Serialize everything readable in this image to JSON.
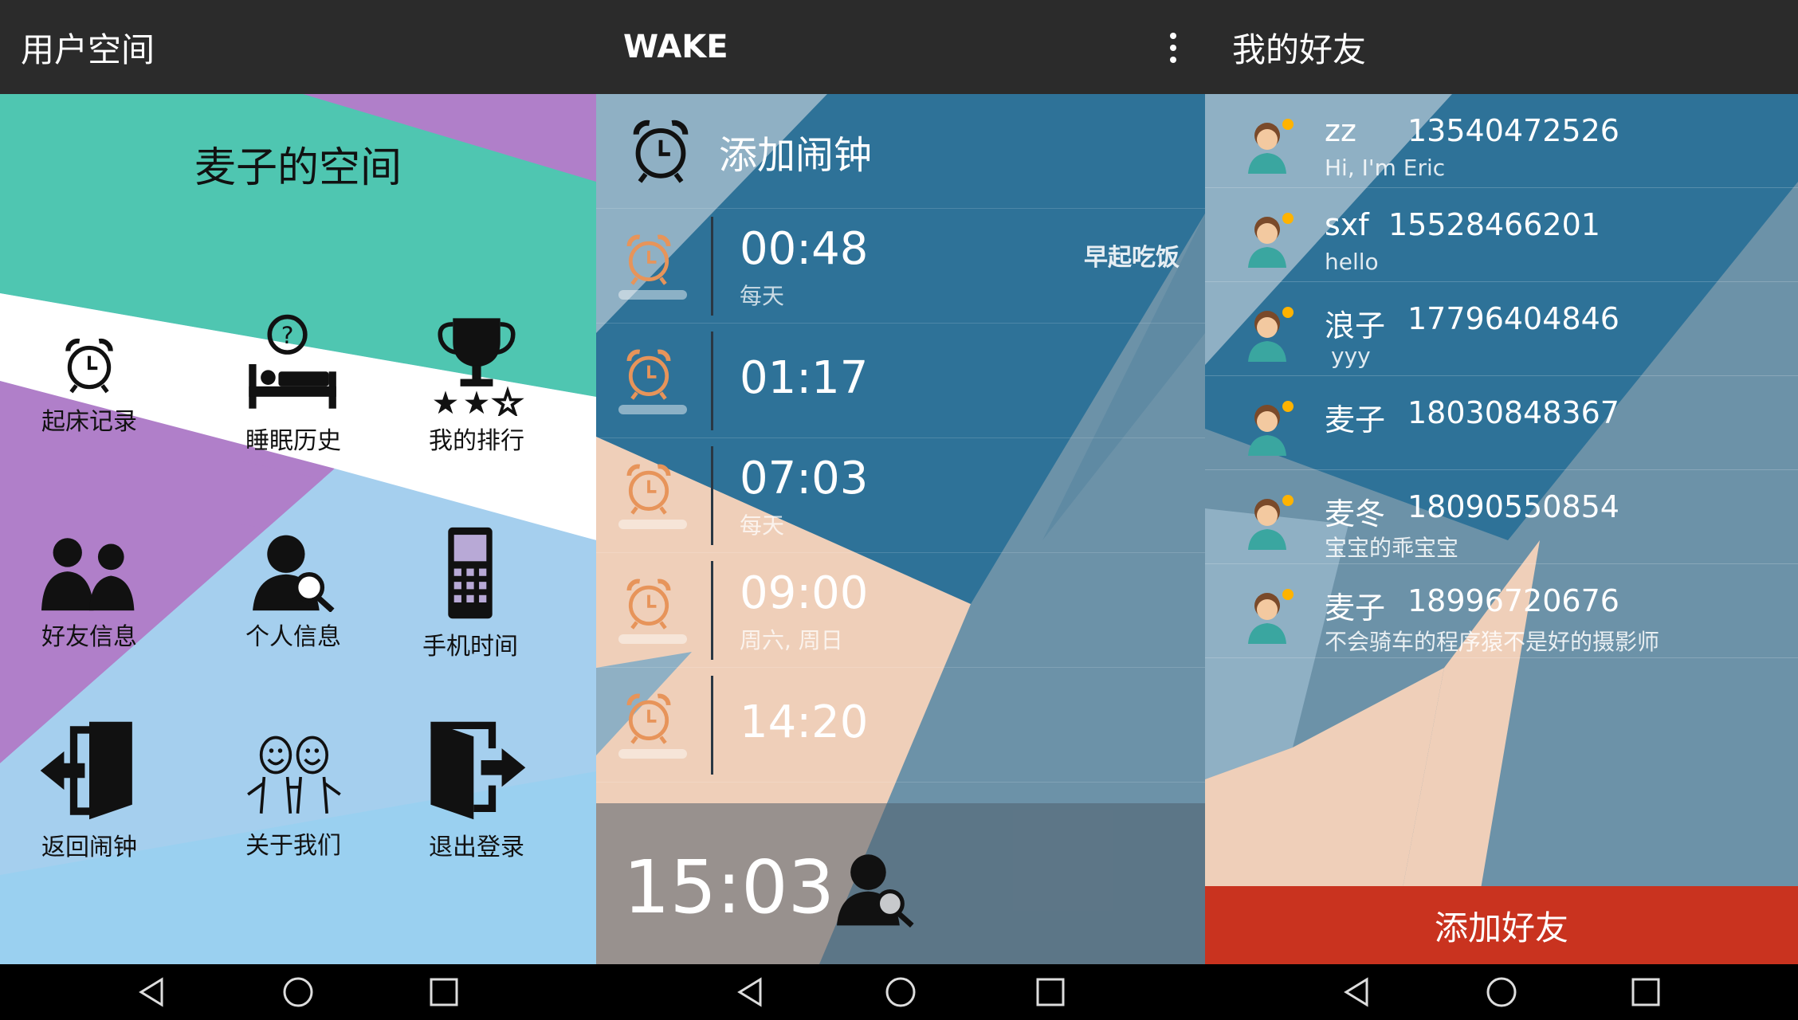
{
  "screen1": {
    "appbar_title": "用户空间",
    "space_title": "麦子的空间",
    "tiles": [
      {
        "label": "起床记录",
        "icon": "alarm-clock-icon"
      },
      {
        "label": "睡眠历史",
        "icon": "bed-question-icon"
      },
      {
        "label": "我的排行",
        "icon": "trophy-stars-icon"
      },
      {
        "label": "好友信息",
        "icon": "two-people-icon"
      },
      {
        "label": "个人信息",
        "icon": "person-search-icon"
      },
      {
        "label": "手机时间",
        "icon": "mobile-phone-icon"
      },
      {
        "label": "返回闹钟",
        "icon": "door-enter-icon"
      },
      {
        "label": "关于我们",
        "icon": "happy-people-icon"
      },
      {
        "label": "退出登录",
        "icon": "door-exit-icon"
      }
    ]
  },
  "screen2": {
    "appbar_title": "WAKE",
    "add_alarm": "添加闹钟",
    "alarms": [
      {
        "time": "00:48",
        "repeat": "每天",
        "note": "早起吃饭"
      },
      {
        "time": "01:17",
        "repeat": "",
        "note": ""
      },
      {
        "time": "07:03",
        "repeat": "每天",
        "note": ""
      },
      {
        "time": "09:00",
        "repeat": "周六, 周日",
        "note": ""
      },
      {
        "time": "14:20",
        "repeat": "",
        "note": ""
      }
    ],
    "current_time": "15:03"
  },
  "screen3": {
    "appbar_title": "我的好友",
    "friends": [
      {
        "name": "zz",
        "phone": "13540472526",
        "message": "Hi, I'm Eric"
      },
      {
        "name": "sxf",
        "phone": "15528466201",
        "message": "hello"
      },
      {
        "name": "浪子",
        "phone": "17796404846",
        "message": "yyy"
      },
      {
        "name": "麦子",
        "phone": "18030848367",
        "message": ""
      },
      {
        "name": "麦冬",
        "phone": "18090550854",
        "message": "宝宝的乖宝宝"
      },
      {
        "name": "麦子",
        "phone": "18996720676",
        "message": "不会骑车的程序猿不是好的摄影师"
      }
    ],
    "add_friend_label": "添加好友"
  },
  "colors": {
    "appbar": "#2b2b2b",
    "teal": "#4fc6b1",
    "purple": "#b07fc9",
    "light_blue": "#a5cfee",
    "slate_blue": "#6c92a8",
    "deep_blue": "#2e7298",
    "peach": "#efcfb9",
    "accent_red": "#c9331f"
  }
}
